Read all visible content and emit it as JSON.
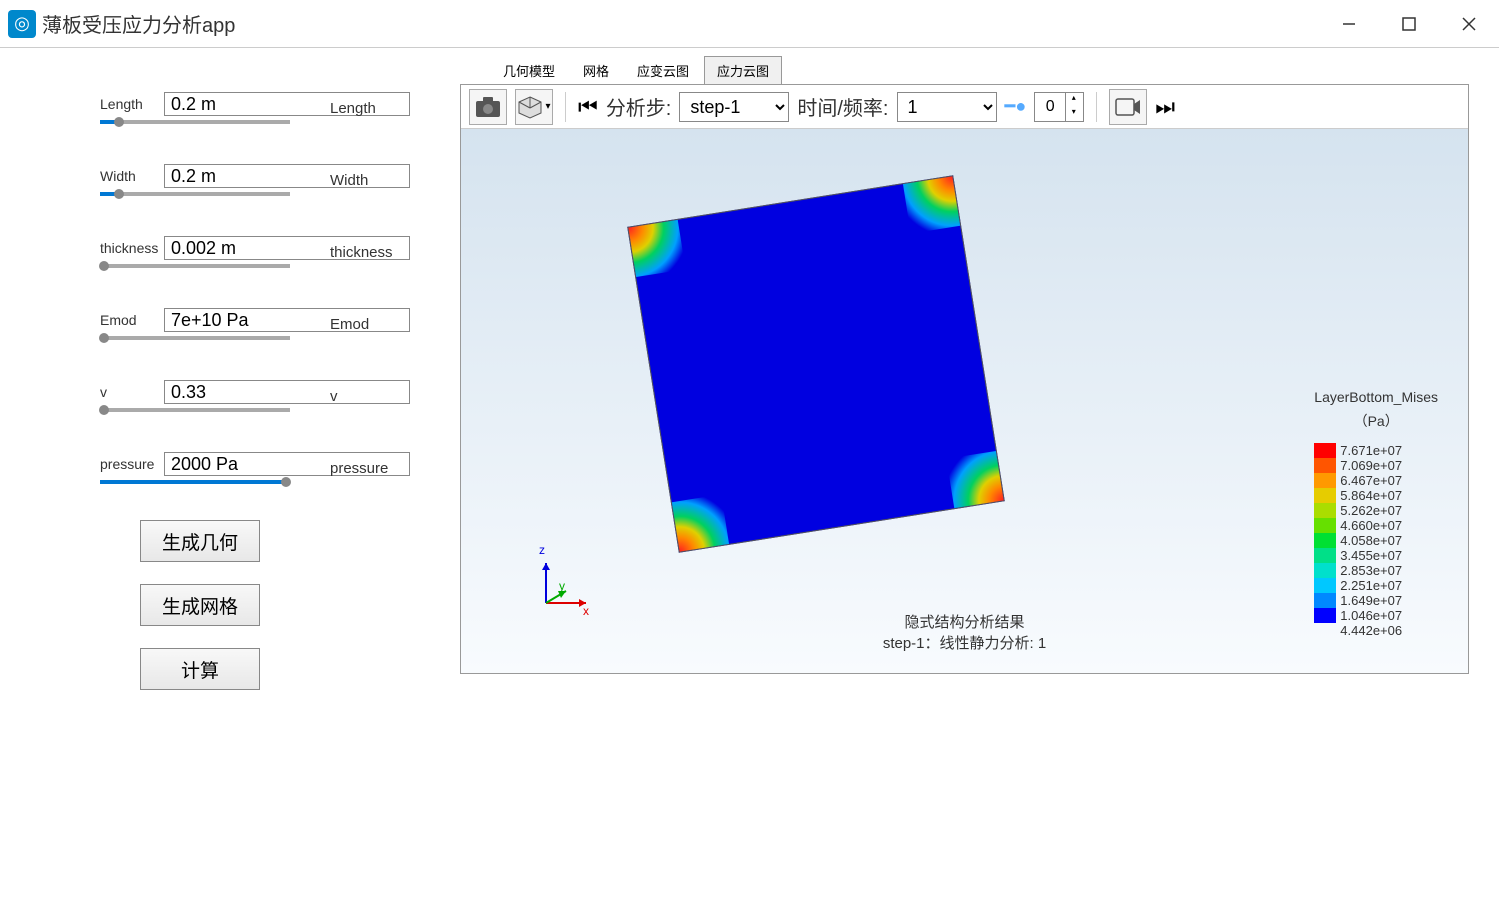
{
  "window": {
    "title": "薄板受压应力分析app"
  },
  "params": {
    "length": {
      "label": "Length",
      "value": "0.2 m",
      "display": "Length",
      "slider_pct": 10
    },
    "width": {
      "label": "Width",
      "value": "0.2 m",
      "display": "Width",
      "slider_pct": 10
    },
    "thickness": {
      "label": "thickness",
      "value": "0.002 m",
      "display": "thickness",
      "slider_pct": 2
    },
    "emod": {
      "label": "Emod",
      "value": "7e+10 Pa",
      "display": "Emod",
      "slider_pct": 2
    },
    "v": {
      "label": "v",
      "value": "0.33",
      "display": "v",
      "slider_pct": 2
    },
    "pressure": {
      "label": "pressure",
      "value": "2000 Pa",
      "display": "pressure",
      "slider_pct": 98
    }
  },
  "buttons": {
    "geom": "生成几何",
    "mesh": "生成网格",
    "calc": "计算"
  },
  "tabs": {
    "geom_model": "几何模型",
    "mesh": "网格",
    "strain": "应变云图",
    "stress": "应力云图"
  },
  "toolbar": {
    "analysis_step_label": "分析步:",
    "analysis_step_value": "step-1",
    "time_freq_label": "时间/频率:",
    "time_freq_value": "1",
    "spinner_value": "0"
  },
  "viewer": {
    "caption_line1": "隐式结构分析结果",
    "caption_line2": "step-1：线性静力分析: 1",
    "triad": {
      "x": "x",
      "y": "y",
      "z": "z"
    }
  },
  "legend": {
    "title": "LayerBottom_Mises",
    "units": "（Pa）",
    "values": [
      "7.671e+07",
      "7.069e+07",
      "6.467e+07",
      "5.864e+07",
      "5.262e+07",
      "4.660e+07",
      "4.058e+07",
      "3.455e+07",
      "2.853e+07",
      "2.251e+07",
      "1.649e+07",
      "1.046e+07",
      "4.442e+06"
    ],
    "colors": [
      "#ff0000",
      "#ff5500",
      "#ff9900",
      "#e6cc00",
      "#aadd00",
      "#66e000",
      "#00e033",
      "#00e088",
      "#00e0cc",
      "#00c8ff",
      "#0088ff",
      "#0000ff"
    ]
  },
  "chart_data": {
    "type": "heatmap",
    "title": "LayerBottom_Mises",
    "units": "Pa",
    "description": "Von Mises stress contour on a thin plate under pressure. Stress concentrates at the four corners (max ~7.67e7 Pa) and is near-uniform low in the interior (~4.44e6 Pa).",
    "colorbar_min": 4442000.0,
    "colorbar_max": 76710000.0,
    "colorbar_ticks": [
      76710000.0,
      70690000.0,
      64670000.0,
      58640000.0,
      52620000.0,
      46600000.0,
      40580000.0,
      34550000.0,
      28530000.0,
      22510000.0,
      16490000.0,
      10460000.0,
      4442000.0
    ]
  }
}
